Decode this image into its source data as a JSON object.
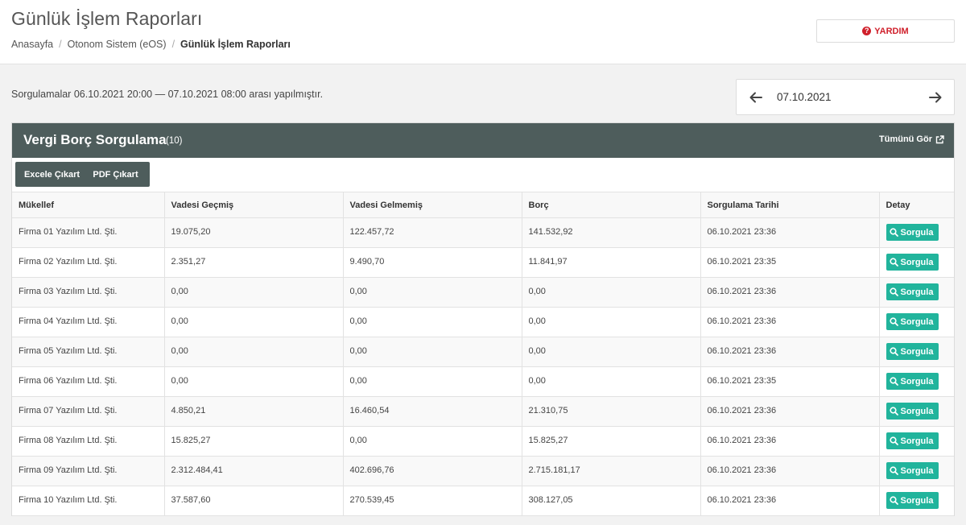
{
  "header": {
    "title": "Günlük İşlem Raporları",
    "breadcrumb": [
      "Anasayfa",
      "Otonom Sistem (eOS)",
      "Günlük İşlem Raporları"
    ],
    "help_label": "YARDIM"
  },
  "info": {
    "text": "Sorgulamalar 06.10.2021 20:00 — 07.10.2021 08:00 arası yapılmıştır."
  },
  "date_nav": {
    "date": "07.10.2021"
  },
  "panel": {
    "title": "Vergi Borç Sorgulama",
    "count": "(10)",
    "view_all_label": "Tümünü Gör",
    "export": {
      "excel_label": "Excele Çıkart",
      "pdf_label": "PDF Çıkart"
    }
  },
  "table": {
    "columns": [
      "Mükellef",
      "Vadesi Geçmiş",
      "Vadesi Gelmemiş",
      "Borç",
      "Sorgulama Tarihi",
      "Detay"
    ],
    "rows": [
      {
        "taxpayer": "Firma 01 Yazılım Ltd. Şti.",
        "overdue": "19.075,20",
        "not_due": "122.457,72",
        "debt": "141.532,92",
        "date": "06.10.2021 23:36",
        "action": "Sorgula"
      },
      {
        "taxpayer": "Firma 02 Yazılım Ltd. Şti.",
        "overdue": "2.351,27",
        "not_due": "9.490,70",
        "debt": "11.841,97",
        "date": "06.10.2021 23:35",
        "action": "Sorgula"
      },
      {
        "taxpayer": "Firma 03 Yazılım Ltd. Şti.",
        "overdue": "0,00",
        "not_due": "0,00",
        "debt": "0,00",
        "date": "06.10.2021 23:36",
        "action": "Sorgula"
      },
      {
        "taxpayer": "Firma 04 Yazılım Ltd. Şti.",
        "overdue": "0,00",
        "not_due": "0,00",
        "debt": "0,00",
        "date": "06.10.2021 23:36",
        "action": "Sorgula"
      },
      {
        "taxpayer": "Firma 05 Yazılım Ltd. Şti.",
        "overdue": "0,00",
        "not_due": "0,00",
        "debt": "0,00",
        "date": "06.10.2021 23:36",
        "action": "Sorgula"
      },
      {
        "taxpayer": "Firma 06 Yazılım Ltd. Şti.",
        "overdue": "0,00",
        "not_due": "0,00",
        "debt": "0,00",
        "date": "06.10.2021 23:35",
        "action": "Sorgula"
      },
      {
        "taxpayer": "Firma 07 Yazılım Ltd. Şti.",
        "overdue": "4.850,21",
        "not_due": "16.460,54",
        "debt": "21.310,75",
        "date": "06.10.2021 23:36",
        "action": "Sorgula"
      },
      {
        "taxpayer": "Firma 08 Yazılım Ltd. Şti.",
        "overdue": "15.825,27",
        "not_due": "0,00",
        "debt": "15.825,27",
        "date": "06.10.2021 23:36",
        "action": "Sorgula"
      },
      {
        "taxpayer": "Firma 09 Yazılım Ltd. Şti.",
        "overdue": "2.312.484,41",
        "not_due": "402.696,76",
        "debt": "2.715.181,17",
        "date": "06.10.2021 23:36",
        "action": "Sorgula"
      },
      {
        "taxpayer": "Firma 10 Yazılım Ltd. Şti.",
        "overdue": "37.587,60",
        "not_due": "270.539,45",
        "debt": "308.127,05",
        "date": "06.10.2021 23:36",
        "action": "Sorgula"
      }
    ]
  },
  "colors": {
    "panel_header": "#4e5d5c",
    "query_button": "#21b49c",
    "help_red": "#d0202b"
  }
}
